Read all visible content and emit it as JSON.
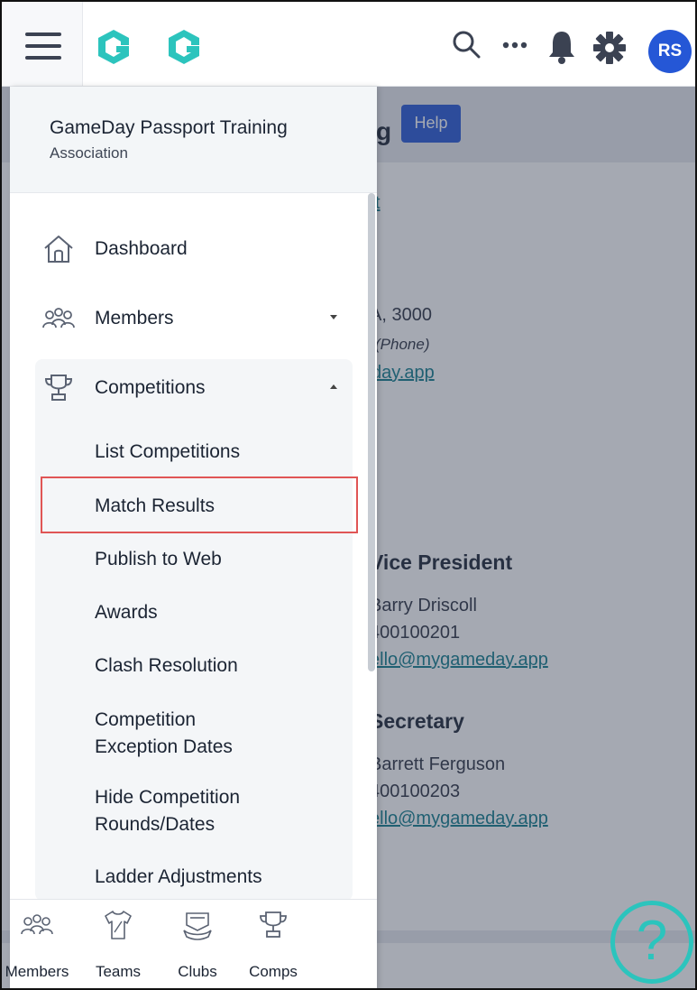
{
  "topbar": {
    "menu_icon": "hamburger-icon",
    "logo_icon": "gameday-logo",
    "icons": [
      "search-icon",
      "more-icon",
      "bell-icon",
      "gear-icon"
    ],
    "avatar_initials": "RS",
    "colors": {
      "avatar": "#2557d6",
      "logo": "#2cc4bd"
    }
  },
  "drawer": {
    "org_name": "GameDay Passport Training",
    "org_type": "Association",
    "nav": {
      "dashboard": "Dashboard",
      "members": "Members",
      "competitions": "Competitions"
    },
    "competition_items": {
      "list": "List Competitions",
      "match_results": "Match Results",
      "publish": "Publish to Web",
      "awards": "Awards",
      "clash": "Clash Resolution",
      "exception_1": "Competition",
      "exception_2": "Exception Dates",
      "hide_1": "Hide Competition",
      "hide_2": "Rounds/Dates",
      "ladder": "Ladder Adjustments"
    }
  },
  "bottom_tabs": {
    "members": "Members",
    "teams": "Teams",
    "clubs": "Clubs",
    "comps": "Comps"
  },
  "background": {
    "title_fragment": "g",
    "help_label": "Help",
    "link_fragment": "t",
    "address_fragment": "A, 3000",
    "phone_label": "(Phone)",
    "email_fragment": "day.app",
    "vp_heading": "Vice President",
    "vp_name": "Barry Driscoll",
    "vp_phone": "400100201",
    "vp_email": "ello@mygameday.app",
    "sec_heading": "Secretary",
    "sec_name": "Barrett Ferguson",
    "sec_phone": "400100203",
    "sec_email": "ello@mygameday.app",
    "help_fab": "?"
  }
}
